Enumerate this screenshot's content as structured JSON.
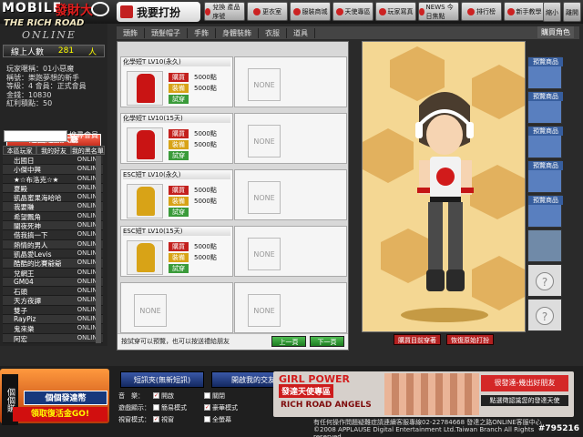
{
  "header": {
    "logo_top": "MOBILE",
    "logo_red": "發財大",
    "logo_mid": "THE RICH ROAD",
    "logo_bottom": "ONLINE",
    "page_title": "我要打扮",
    "nav": [
      {
        "label": "兌換\n產品序號",
        "icon": "gift-icon"
      },
      {
        "label": "更衣室",
        "icon": "hanger-icon"
      },
      {
        "label": "服裝商城",
        "icon": "shop-icon"
      },
      {
        "label": "天使專區",
        "icon": "angel-icon"
      },
      {
        "label": "玩家寫真",
        "icon": "camera-icon"
      },
      {
        "label": "NEWS\n今日焦點",
        "icon": "news-icon"
      },
      {
        "label": "排行榜",
        "icon": "rank-icon"
      },
      {
        "label": "新手教學",
        "icon": "tutorial-icon"
      }
    ],
    "window": {
      "minimize": "縮小",
      "close": "離開"
    }
  },
  "online": {
    "label": "線上人數",
    "count": "281",
    "unit": "人"
  },
  "player": {
    "lines": [
      "玩家暱稱：01小惡魔",
      "稱號：樂跑夢想的新手",
      "等級：4    會員：正式會員",
      "金錢：10830",
      "紅利積點：50"
    ]
  },
  "left": {
    "return_button": "返回遊戲大廳",
    "search_button": "搜尋會員",
    "tabs": [
      "本區玩家",
      "我的好友",
      "我的黑名單"
    ],
    "friends": [
      {
        "name": "出國日",
        "status": "ONLINE"
      },
      {
        "name": "小傑中興",
        "status": "ONLINE"
      },
      {
        "name": "★☆布洛克☆★",
        "status": "ONLINE"
      },
      {
        "name": "夏殿",
        "status": "ONLINE"
      },
      {
        "name": "凱晶蜜果海哈哈",
        "status": "ONLINE"
      },
      {
        "name": "我要賺",
        "status": "ONLINE"
      },
      {
        "name": "希望飄角",
        "status": "ONLINE"
      },
      {
        "name": "闇夜死神",
        "status": "ONLINE"
      },
      {
        "name": "借我搞一下",
        "status": "ONLINE"
      },
      {
        "name": "熱情的男人",
        "status": "ONLINE"
      },
      {
        "name": "凱晶愛Levis",
        "status": "ONLINE"
      },
      {
        "name": "酷酷的比賽爺爺",
        "status": "ONLINE"
      },
      {
        "name": "兌網王",
        "status": "ONLINE"
      },
      {
        "name": "GM04",
        "status": "ONLINE"
      },
      {
        "name": "石頭",
        "status": "ONLINE"
      },
      {
        "name": "天方夜譚",
        "status": "ONLINE"
      },
      {
        "name": "雙子",
        "status": "ONLINE"
      },
      {
        "name": "RayPiz",
        "status": "ONLINE"
      },
      {
        "name": "鬼來樂",
        "status": "ONLINE"
      },
      {
        "name": "阿宏",
        "status": "ONLINE"
      }
    ]
  },
  "categories": [
    "頭飾",
    "頭髮帽子",
    "手飾",
    "身體裝飾",
    "衣服",
    "道具"
  ],
  "buy_package": "購買角色",
  "store": {
    "items": [
      {
        "title": "化學短T LV10(永久)",
        "buy": "購買",
        "equip": "裝備",
        "try": "試穿",
        "price1": "5000點",
        "price2": "5000點",
        "color": "#c91414"
      },
      {
        "title": "化學短T LV10(15天)",
        "buy": "購買",
        "equip": "裝備",
        "try": "試穿",
        "price1": "5000點",
        "price2": "5000點",
        "color": "#c91414"
      },
      {
        "title": "ESC短T LV10(永久)",
        "buy": "購買",
        "equip": "裝備",
        "try": "試穿",
        "price1": "5000點",
        "price2": "5000點",
        "color": "#d8a317"
      },
      {
        "title": "ESC短T LV10(15天)",
        "buy": "購買",
        "equip": "裝備",
        "try": "試穿",
        "price1": "5000點",
        "price2": "5000點",
        "color": "#d8a317"
      }
    ],
    "none_label": "NONE",
    "hint": "按試穿可以預覽，也可以按送禮給朋友",
    "prev": "上一頁",
    "next": "下一頁"
  },
  "preview": {
    "buttons": [
      "購買目前穿著",
      "恢復原始打扮"
    ]
  },
  "thumbs": {
    "label": "預覽商品",
    "count_shown": 5
  },
  "footer": {
    "promo_vertical": "個個賺",
    "promo_title": "個個發達幣",
    "promo_sub": "領取復活金GO!",
    "msg_button": "短訊夾(無新短訊)",
    "friends_button": "開啟我的交友",
    "settings": [
      {
        "k": "音　樂：",
        "opts": [
          {
            "label": "開啟",
            "checked": true
          },
          {
            "label": "關閉",
            "checked": false
          }
        ]
      },
      {
        "k": "遊戲顯示：",
        "opts": [
          {
            "label": "簡易模式",
            "checked": false
          },
          {
            "label": "豪華模式",
            "checked": true
          }
        ]
      },
      {
        "k": "視窗模式：",
        "opts": [
          {
            "label": "視窗",
            "checked": true
          },
          {
            "label": "全螢幕",
            "checked": false
          }
        ]
      }
    ],
    "banner_title": "GIRL POWER",
    "banner_red": "發達天使專區",
    "banner_bottom": "RICH ROAD ANGELS",
    "banner_join": "很發達-幾出好朋友",
    "banner_sub": "點選徵認識您的發達天使",
    "copyright": "有任何操作問題疑難症請連續客服專線02-22784668 發達之路ONLINE客服中心\n©2008 APPLAUSE Digital Entertainment Ltd.Taiwan Branch All Rights reserved.",
    "account_id": "#795216"
  }
}
